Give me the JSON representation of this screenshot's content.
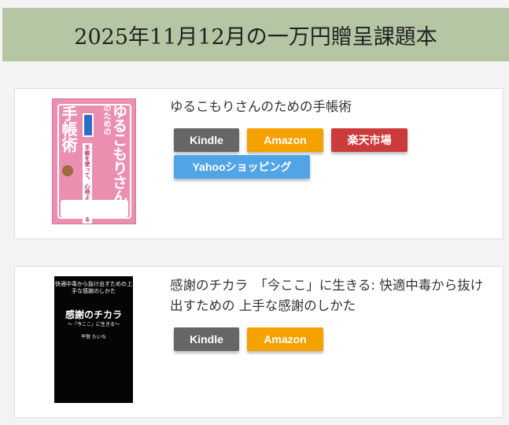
{
  "header": {
    "title": "2025年11月12月の一万円贈呈課題本"
  },
  "books": [
    {
      "title": "ゆるこもりさんのための手帳術",
      "cover": {
        "title_vertical": "ゆるこもりさん",
        "title_small": "のための",
        "title_techo": "手帳術",
        "sub": "手帳を使って、心地よく生きる"
      },
      "buttons": {
        "kindle": "Kindle",
        "amazon": "Amazon",
        "rakuten": "楽天市場",
        "yahoo": "Yahooショッピング"
      }
    },
    {
      "title": "感謝のチカラ　「今ここ」に生きる: 快適中毒から抜け出すための 上手な感謝のしかた",
      "cover": {
        "top": "快適中毒から抜け出すための上手な感謝のしかた",
        "main": "感謝のチカラ",
        "sub": "〜「今ここ」に生きる〜",
        "author": "平賀 たいち"
      },
      "buttons": {
        "kindle": "Kindle",
        "amazon": "Amazon"
      }
    }
  ],
  "colors": {
    "header_bg": "#b4c6a4",
    "kindle": "#666666",
    "amazon": "#f5a100",
    "rakuten": "#cb3b3b",
    "yahoo": "#51a5e6"
  }
}
